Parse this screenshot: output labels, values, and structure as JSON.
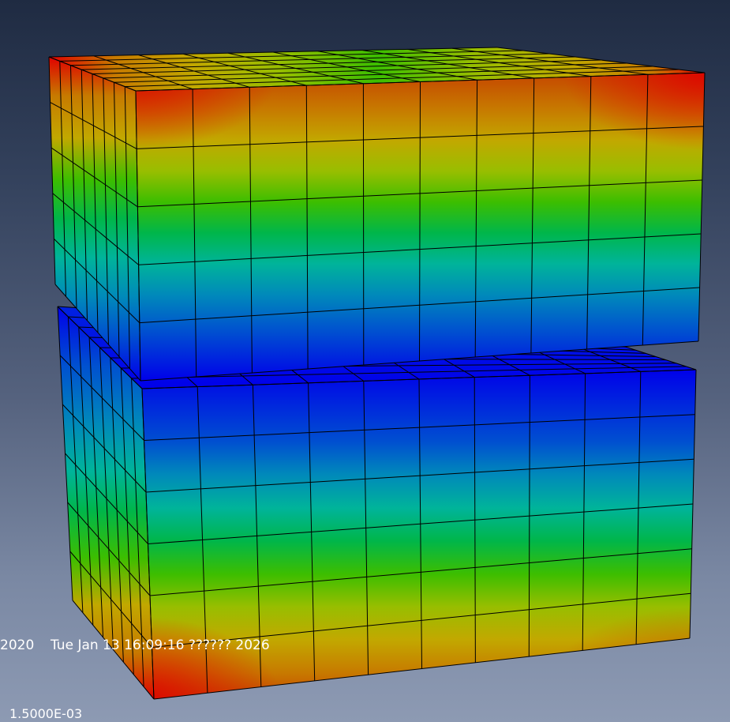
{
  "viewport": {
    "background_top": "#1f2b42",
    "background_bottom": "#8d9ab3",
    "mesh_color": "#000000",
    "palette": [
      "#0000ea",
      "#0050d0",
      "#008aba",
      "#00b49a",
      "#00b64a",
      "#3cbe00",
      "#98be00",
      "#c2a800",
      "#c77a00",
      "#c64600",
      "#e00000"
    ]
  },
  "status": {
    "version": "2020",
    "timestamp": "Tue Jan 13 16:09:16 ?????? 2026"
  },
  "scale_factor": "1.5000E-03",
  "model": {
    "upper_block": {
      "label": "upper-block",
      "top_band": "warm",
      "bottom_band": "blue"
    },
    "lower_block": {
      "label": "lower-block",
      "top_band": "blue",
      "bottom_band": "warm"
    }
  }
}
